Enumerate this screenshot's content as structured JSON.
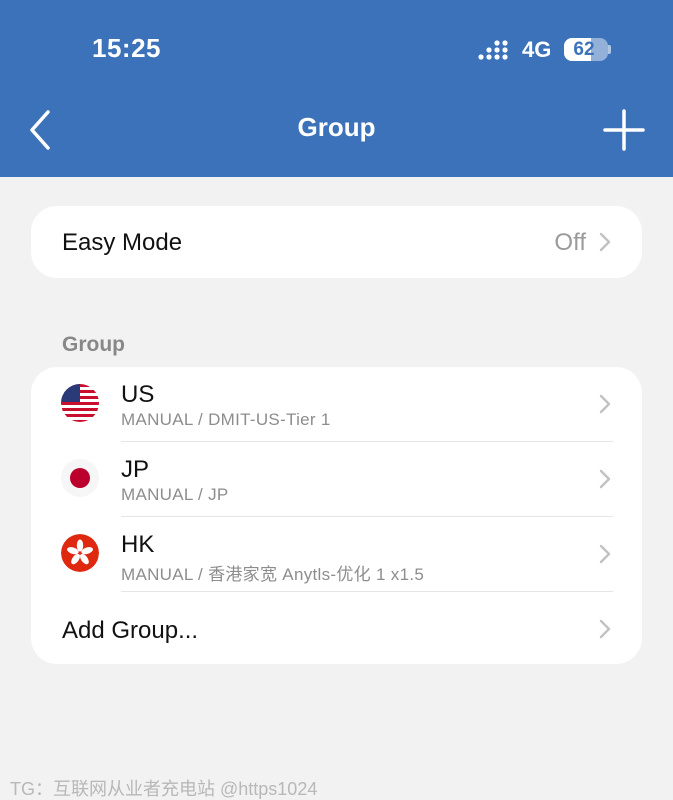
{
  "status_bar": {
    "time": "15:25",
    "network": "4G",
    "battery_percent": "62",
    "battery_level": 0.62,
    "icons": {
      "signal": "cellular-signal-icon",
      "battery": "battery-icon"
    }
  },
  "nav": {
    "title": "Group",
    "back_icon": "chevron-left-icon",
    "add_icon": "plus-icon"
  },
  "easy_mode": {
    "label": "Easy Mode",
    "value": "Off"
  },
  "groups_section": {
    "title": "Group",
    "items": [
      {
        "name": "US",
        "detail": "MANUAL / DMIT-US-Tier 1",
        "flag": "us-flag-icon"
      },
      {
        "name": "JP",
        "detail": "MANUAL / JP",
        "flag": "jp-flag-icon"
      },
      {
        "name": "HK",
        "detail": "MANUAL / 香港家宽 Anytls-优化 1 x1.5",
        "flag": "hk-flag-icon"
      }
    ],
    "add_label": "Add Group..."
  },
  "watermark": "TG：互联网从业者充电站 @https1024",
  "colors": {
    "header": "#3b72b9",
    "background": "#f2f2f2",
    "card": "#ffffff",
    "secondary_text": "#8d8d8d",
    "jp_red": "#bc002d",
    "hk_red": "#de2910"
  }
}
